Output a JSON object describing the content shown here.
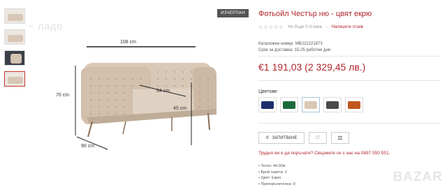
{
  "watermark": "~ ладо",
  "thumbnails": [
    {
      "name": "thumb-1"
    },
    {
      "name": "thumb-2"
    },
    {
      "name": "thumb-3"
    },
    {
      "name": "thumb-4"
    }
  ],
  "image": {
    "badge": "ИЗЧЕРПАН",
    "dims": {
      "width": "108 cm",
      "height": "70 cm",
      "depth": "90 cm",
      "seat_depth": "64 cm",
      "seat_height": "45 cm"
    }
  },
  "product": {
    "title": "Фотьойл Честър ню - цвят екрю",
    "stars": "☆☆☆☆☆",
    "no_reviews": "Не бъде 0 отзива",
    "dash": "-",
    "write_review": "Напишете отзив",
    "catalog_label": "Каталожен номер:",
    "catalog_value": "МВ222221873",
    "delivery_label": "Срок за доставка:",
    "delivery_value": "15-25 работни дни",
    "price": "€1 191,03 (2 329,45 лв.)",
    "colors_label": "Цветове",
    "colors": [
      "#1f2f6e",
      "#1d6b3b",
      "#d9c8b4",
      "#4a4a4a",
      "#c0561f"
    ],
    "selected_color_index": 2,
    "save_button": "ЗАПИТВАНЕ",
    "heart_icon": "♡",
    "scale_icon": "⚖",
    "question": "Трудно ви е да поръчате? Свържете се с нас на 0897 550 551.",
    "specs": [
      "• Тегло: 44.00кг",
      "• Брой пакети: 1",
      "• Цвят: Екрю",
      "• Препоръчителна: 9"
    ]
  },
  "brand_watermark": "BAZAR",
  "colors": {
    "accent": "#b0232a",
    "armchair": "#d8c7b6"
  }
}
